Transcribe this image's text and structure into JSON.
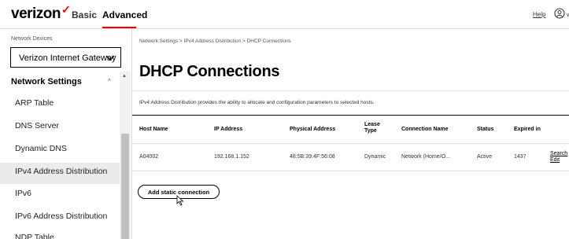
{
  "header": {
    "logo": "verizon",
    "logo_mark": "✓",
    "tabs": [
      "Basic",
      "Advanced"
    ],
    "active_tab": "Advanced",
    "help": "Help",
    "account_icon": "account-icon",
    "account_trailing": "∨",
    "accent_color": "#ee0000"
  },
  "sidebar": {
    "device_label": "Network Devices",
    "device_select": "Verizon Internet Gateway",
    "section_title": "Network Settings",
    "section_chevron": "^",
    "scroll_arrow": "▲",
    "items": [
      "ARP Table",
      "DNS Server",
      "Dynamic DNS",
      "IPv4 Address Distribution",
      "IPv6",
      "IPv6 Address Distribution",
      "NDP Table"
    ],
    "active_item": "IPv4 Address Distribution"
  },
  "main": {
    "breadcrumb": "Network Settings  >  IPv4 Address Distribution  >  DHCP Connections",
    "title": "DHCP Connections",
    "description": "IPv4 Address Distribution provides the ability to allocate and configuration parameters to selected hosts.",
    "table": {
      "headers": [
        "Host Name",
        "IP Address",
        "Physical Address",
        "Lease Type",
        "Connection Name",
        "Status",
        "Expired in"
      ],
      "rows": [
        {
          "host": "A04002",
          "ip": "192.168.1.152",
          "mac": "48:5B:39:4F:56:08",
          "lease": "Dynamic",
          "connection": "Network (Home/O...",
          "status": "Active",
          "expires": "1437",
          "actions": [
            "Search",
            "Edit"
          ]
        }
      ]
    },
    "add_button": "Add static connection"
  }
}
